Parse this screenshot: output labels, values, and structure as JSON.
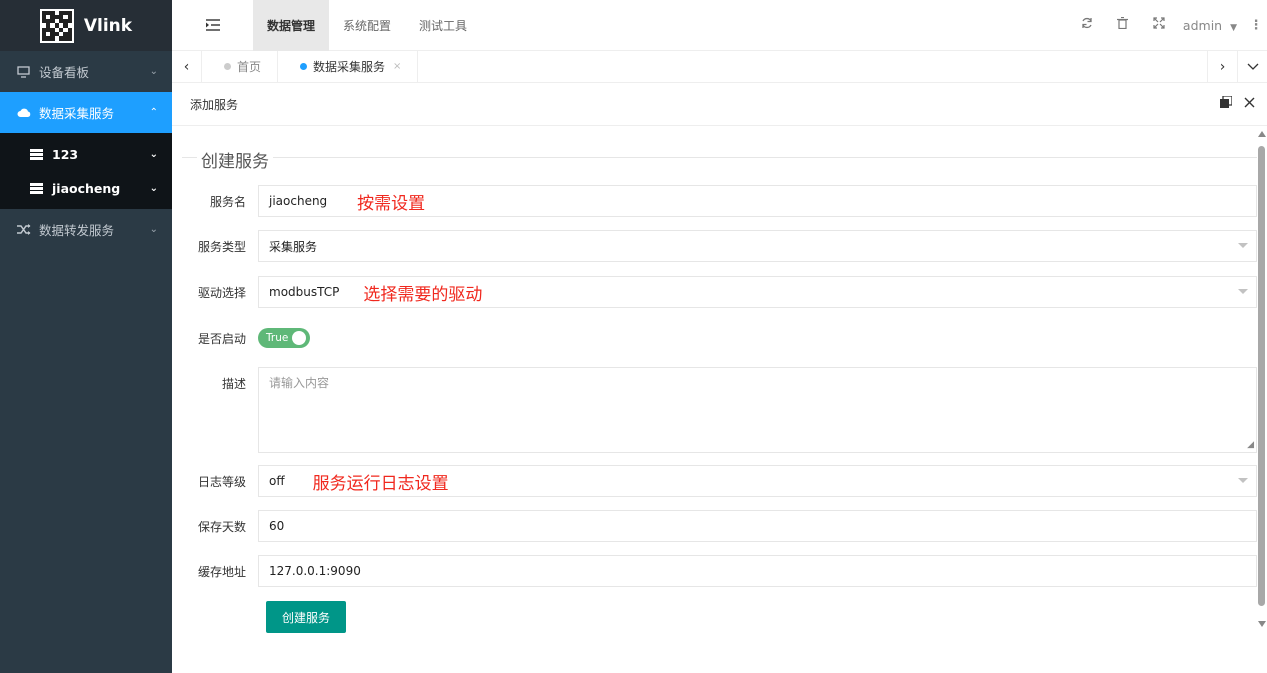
{
  "app": {
    "name": "Vlink"
  },
  "sidebar": {
    "items": [
      {
        "label": "设备看板",
        "icon": "monitor-icon",
        "chevron": "⌄"
      },
      {
        "label": "数据采集服务",
        "icon": "cloud-icon",
        "chevron": "⌃"
      },
      {
        "label": "123",
        "icon": "server-icon",
        "chevron": "⌄"
      },
      {
        "label": "jiaocheng",
        "icon": "server-icon",
        "chevron": "⌄"
      },
      {
        "label": "数据转发服务",
        "icon": "shuffle-icon",
        "chevron": "⌄"
      }
    ]
  },
  "header": {
    "tabs": [
      "数据管理",
      "系统配置",
      "测试工具"
    ],
    "user": "admin"
  },
  "tabbar": {
    "tabs": [
      {
        "label": "首页"
      },
      {
        "label": "数据采集服务",
        "close": "×"
      }
    ]
  },
  "panel": {
    "title": "添加服务"
  },
  "form": {
    "legend": "创建服务",
    "fields": {
      "name": {
        "label": "服务名",
        "value": "jiaocheng",
        "note": "按需设置"
      },
      "type": {
        "label": "服务类型",
        "value": "采集服务"
      },
      "driver": {
        "label": "驱动选择",
        "value": "modbusTCP",
        "note": "选择需要的驱动"
      },
      "enabled": {
        "label": "是否启动",
        "value": "True"
      },
      "description": {
        "label": "描述",
        "placeholder": "请输入内容"
      },
      "log_level": {
        "label": "日志等级",
        "value": "off",
        "note": "服务运行日志设置"
      },
      "retention": {
        "label": "保存天数",
        "value": "60"
      },
      "cache": {
        "label": "缓存地址",
        "value": "127.0.0.1:9090"
      }
    },
    "submit": "创建服务"
  },
  "colors": {
    "accent": "#1e9fff",
    "sidebar": "#2b3a45",
    "submit": "#009688",
    "toggle": "#5fb878",
    "note": "#f0281e"
  }
}
